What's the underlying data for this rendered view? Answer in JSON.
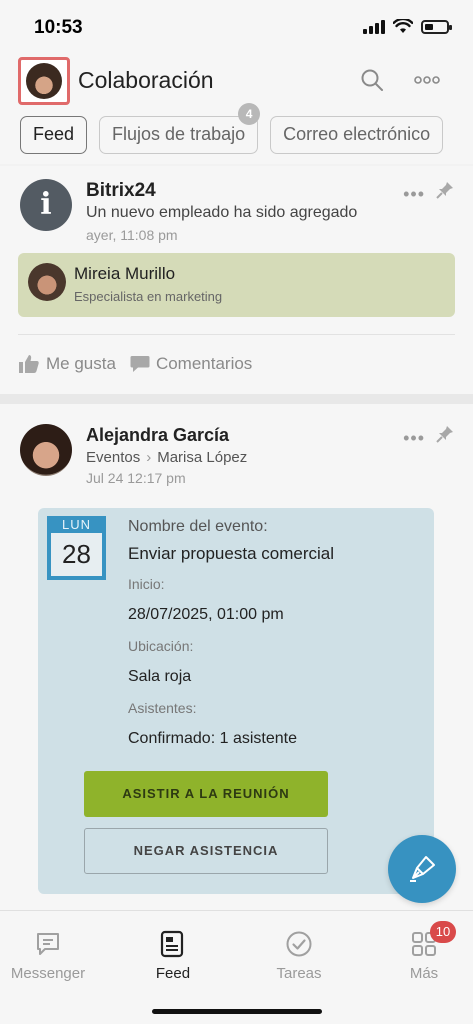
{
  "status_bar": {
    "time": "10:53"
  },
  "header": {
    "title": "Colaboración",
    "tabs": [
      {
        "label": "Feed",
        "active": true
      },
      {
        "label": "Flujos de trabajo",
        "badge": "4"
      },
      {
        "label": "Correo electrónico"
      }
    ]
  },
  "posts": [
    {
      "author": "Bitrix24",
      "text": "Un nuevo empleado ha sido agregado",
      "time": "ayer, 11:08 pm",
      "new_employee": {
        "name": "Mireia Murillo",
        "role": "Especialista en marketing"
      },
      "like_label": "Me gusta",
      "comments_label": "Comentarios"
    },
    {
      "author": "Alejandra García",
      "destination": "Eventos",
      "recipient": "Marisa López",
      "time": "Jul 24 12:17 pm",
      "event": {
        "month": "LUN",
        "day": "28",
        "name_label": "Nombre del evento:",
        "name": "Enviar propuesta comercial",
        "start_label": "Inicio:",
        "start": "28/07/2025, 01:00 pm",
        "location_label": "Ubicación:",
        "location": "Sala roja",
        "attendees_label": "Asistentes:",
        "attendees": "Confirmado: 1 asistente",
        "attend_button": "ASISTIR A LA REUNIÓN",
        "decline_button": "NEGAR ASISTENCIA"
      }
    }
  ],
  "bottom_nav": [
    {
      "label": "Messenger",
      "icon": "chat-icon"
    },
    {
      "label": "Feed",
      "icon": "feed-icon",
      "active": true
    },
    {
      "label": "Tareas",
      "icon": "check-circle-icon"
    },
    {
      "label": "Más",
      "icon": "grid-icon",
      "badge": "10"
    }
  ],
  "colors": {
    "accent": "#3792c1",
    "attend_button": "#8fb32b",
    "badge": "#d94a4a"
  }
}
